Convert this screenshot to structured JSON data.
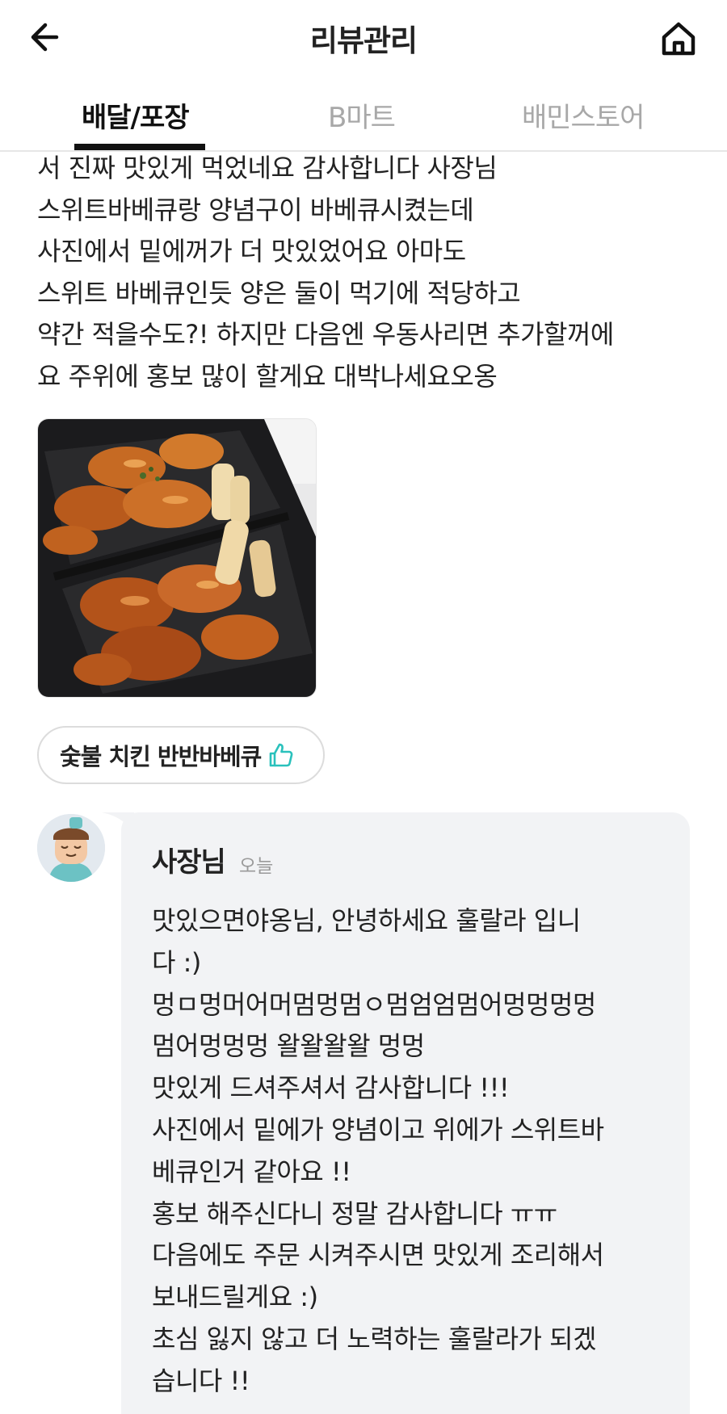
{
  "header": {
    "title": "리뷰관리",
    "back_icon": "arrow-left-icon",
    "home_icon": "home-icon"
  },
  "tabs": [
    {
      "label": "배달/포장",
      "active": true
    },
    {
      "label": "B마트",
      "active": false
    },
    {
      "label": "배민스토어",
      "active": false
    }
  ],
  "review": {
    "lines": [
      "서 진짜 맛있게 먹었네요 감사합니다 사장님",
      "스위트바베큐랑 양념구이 바베큐시켰는데",
      "사진에서 밑에꺼가 더 맛있었어요 아마도",
      "스위트 바베큐인듯 양은 둘이 먹기에 적당하고",
      "약간 적을수도?! 하지만 다음엔 우동사리면 추가할꺼에",
      "요 주위에 홍보 많이 할게요 대박나세요오옹"
    ],
    "photo_icon": "food-photo",
    "menu_chip": {
      "label": "숯불 치킨 반반바베큐",
      "icon": "thumbs-up-icon",
      "accent": "#2ac1bc"
    }
  },
  "reply": {
    "author": "사장님",
    "time": "오늘",
    "avatar_icon": "owner-avatar",
    "bubble_color": "#f2f3f5",
    "lines": [
      "맛있으면야옹님,  안녕하세요 훌랄라 입니",
      "다 :)",
      "멍ㅁ멍머어머멈멍멈ㅇ멈엄엄멈어멍멍멍멍",
      "멈어멍멍멍 왈왈왈왈 멍멍",
      "맛있게 드셔주셔서 감사합니다 !!!",
      "사진에서 밑에가 양념이고 위에가 스위트바",
      "베큐인거 같아요 !!",
      "홍보 해주신다니 정말 감사합니다 ㅠㅠ",
      "다음에도 주문 시켜주시면 맛있게 조리해서",
      "보내드릴게요 :)",
      "초심 잃지 않고 더 노력하는 훌랄라가 되겠",
      "습니다 !!"
    ]
  }
}
